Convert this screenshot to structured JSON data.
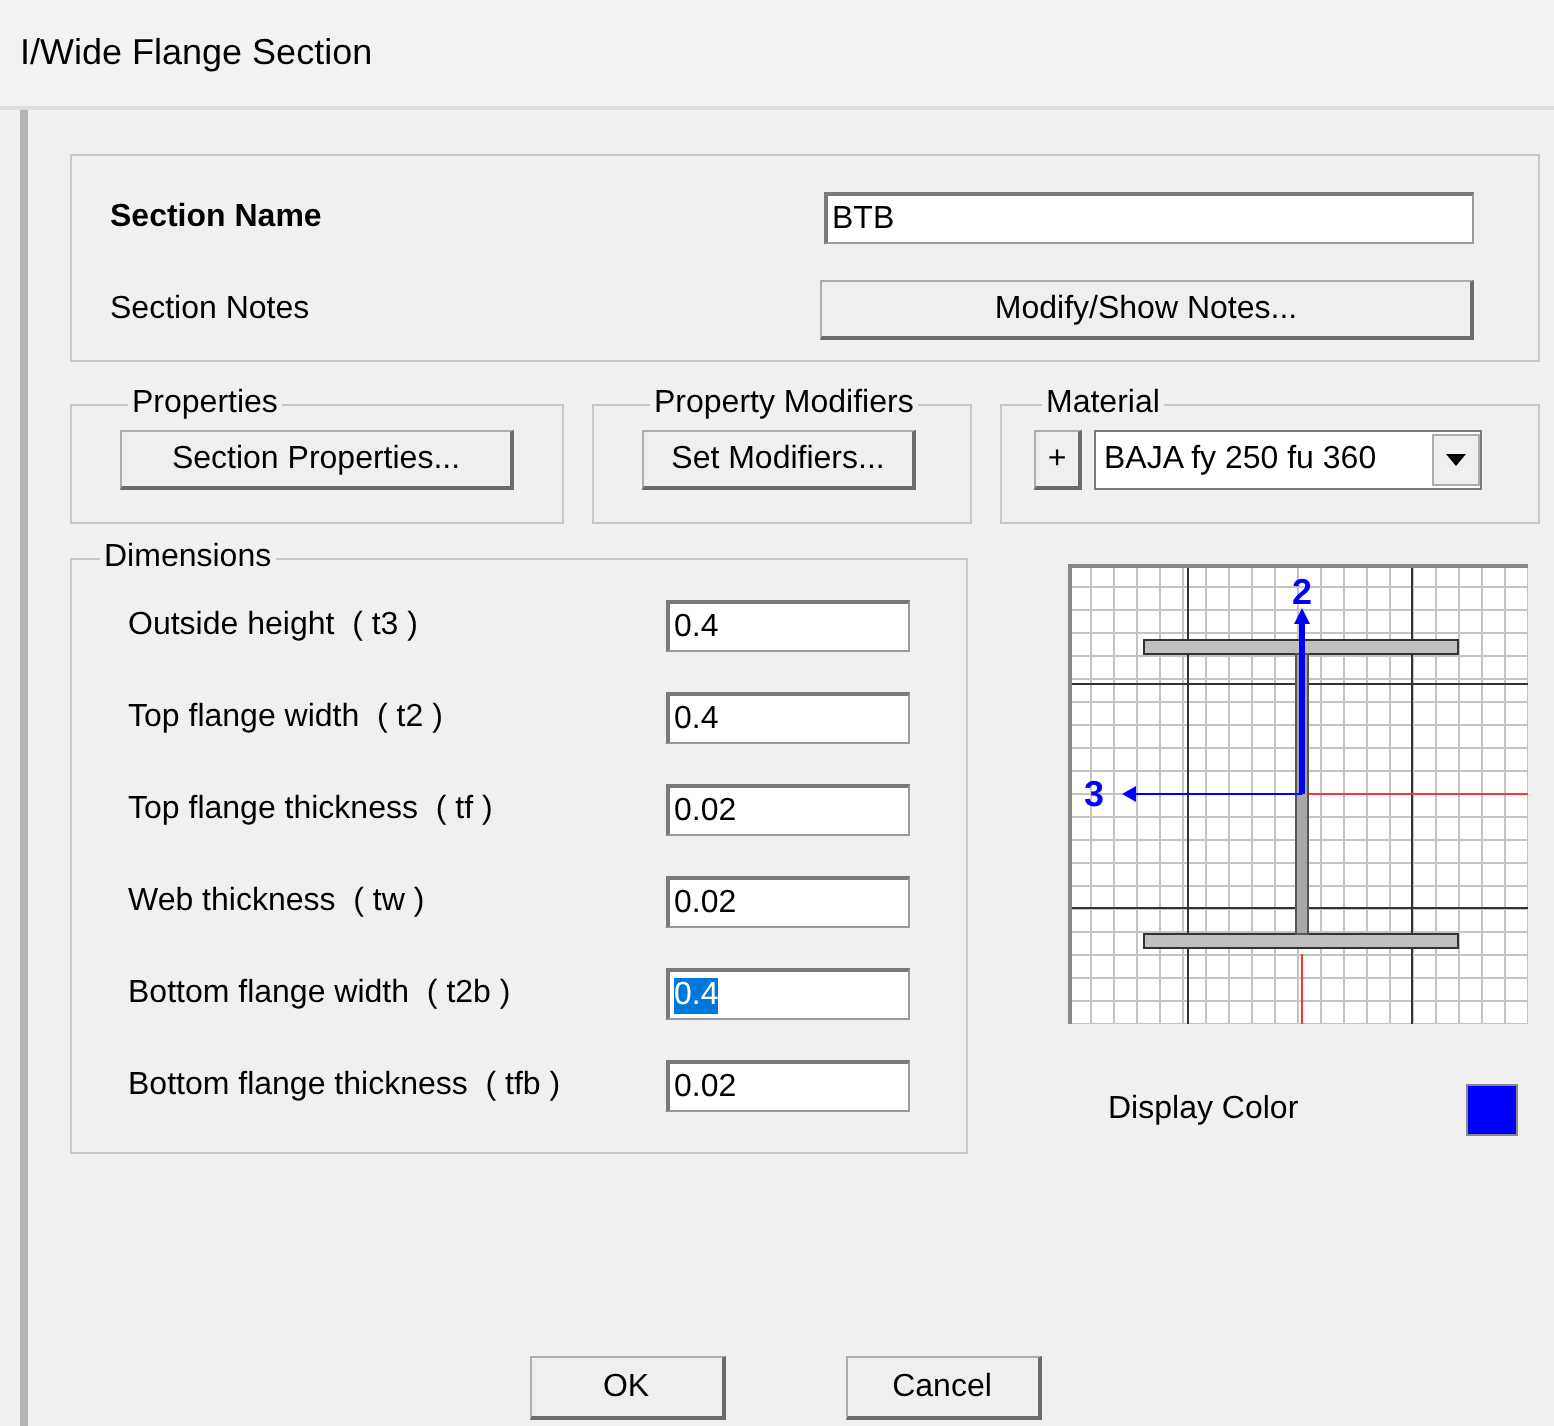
{
  "window": {
    "title": "I/Wide Flange Section"
  },
  "section": {
    "name_label": "Section Name",
    "name_value": "BTB",
    "notes_label": "Section Notes",
    "notes_button": "Modify/Show Notes..."
  },
  "properties": {
    "title": "Properties",
    "button": "Section Properties..."
  },
  "property_modifiers": {
    "title": "Property Modifiers",
    "button": "Set Modifiers..."
  },
  "material": {
    "title": "Material",
    "add_button": "+",
    "value": "BAJA fy 250 fu 360"
  },
  "dimensions": {
    "title": "Dimensions",
    "rows": [
      {
        "label": "Outside height  ( t3 )",
        "value": "0.4",
        "selected": false
      },
      {
        "label": "Top flange width  ( t2 )",
        "value": "0.4",
        "selected": false
      },
      {
        "label": "Top flange thickness  ( tf )",
        "value": "0.02",
        "selected": false
      },
      {
        "label": "Web thickness  ( tw )",
        "value": "0.02",
        "selected": false
      },
      {
        "label": "Bottom flange width  ( t2b )",
        "value": "0.4",
        "selected": true
      },
      {
        "label": "Bottom flange thickness  ( tfb )",
        "value": "0.02",
        "selected": false
      }
    ]
  },
  "preview": {
    "axis_2_label": "2",
    "axis_3_label": "3"
  },
  "display_color": {
    "label": "Display Color",
    "color": "#0000ff"
  },
  "buttons": [
    "OK",
    "Cancel"
  ]
}
